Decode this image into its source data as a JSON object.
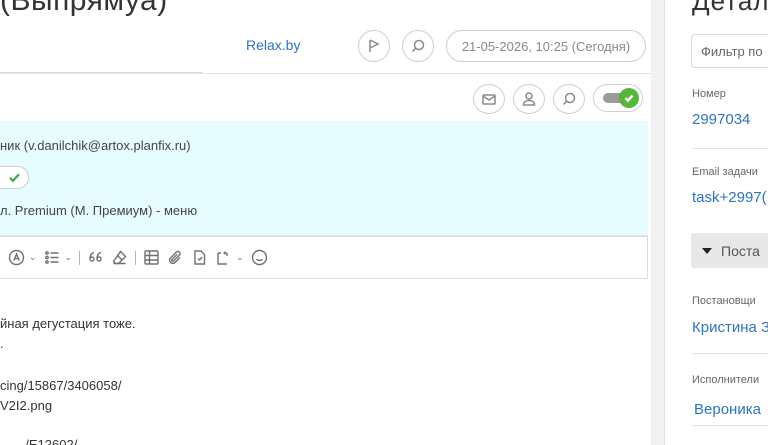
{
  "header": {
    "title": "(Выпрямуа)",
    "link": "Relax.by",
    "date": "21-05-2026, 10:25 (Сегодня)"
  },
  "message": {
    "sender": "ник (v.danilchik@artox.planfix.ru)",
    "recipient": "л. Premium (М. Премиум) - меню",
    "toggle_on": true
  },
  "editor": {
    "line1": "йная дегустация тоже.",
    "line2": ".",
    "line3": "cing/15867/3406058/",
    "line4": "V2I2.png",
    "line5": "...... /E12602/"
  },
  "sidebar": {
    "title": "Детал",
    "filter_placeholder": "Фильтр по",
    "number_label": "Номер",
    "number_value": "2997034",
    "email_label": "Email задачи",
    "email_value": "task+2997(",
    "section_label": "Поста",
    "setter_label": "Постановщи",
    "setter_value": "Кристина З",
    "executor_label": "Исполнители",
    "executor_value": "Вероника"
  },
  "colors": {
    "accent": "#2b74c6",
    "panel_bg": "#e6fcff",
    "toggle_on": "#55b63a"
  }
}
